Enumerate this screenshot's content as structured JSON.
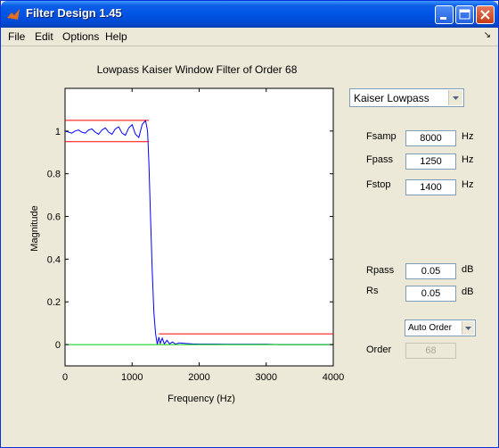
{
  "window": {
    "title": "Filter Design 1.45",
    "icon": "matlab-icon",
    "controls": [
      "minimize-icon",
      "maximize-icon",
      "close-icon"
    ]
  },
  "menu": [
    "File",
    "Edit",
    "Options",
    "Help"
  ],
  "plot": {
    "title": "Lowpass Kaiser Window Filter of Order 68",
    "xlabel": "Frequency (Hz)",
    "ylabel": "Magnitude"
  },
  "chart_data": {
    "type": "line",
    "title": "Lowpass Kaiser Window Filter of Order 68",
    "xlabel": "Frequency (Hz)",
    "ylabel": "Magnitude",
    "xlim": [
      0,
      4000
    ],
    "ylim": [
      -0.1,
      1.2
    ],
    "xticks": [
      "0",
      "1000",
      "2000",
      "3000",
      "4000"
    ],
    "yticks": [
      "0",
      "0.2",
      "0.4",
      "0.6",
      "0.8",
      "1"
    ],
    "grid": false,
    "series": [
      {
        "role": "magnitude response",
        "color": "#0000ff",
        "x": [
          0,
          50,
          100,
          150,
          200,
          250,
          300,
          350,
          400,
          450,
          500,
          550,
          600,
          650,
          700,
          750,
          800,
          850,
          900,
          950,
          1000,
          1050,
          1100,
          1150,
          1200,
          1230,
          1250,
          1275,
          1300,
          1325,
          1350,
          1375,
          1400,
          1420,
          1450,
          1480,
          1520,
          1560,
          1600,
          1650,
          1700,
          1800,
          1900,
          2000,
          2200,
          2400,
          2600,
          2800,
          3000,
          3200,
          3400,
          3600,
          3800,
          4000
        ],
        "y": [
          1.0,
          0.995,
          0.99,
          1.0,
          1.005,
          0.995,
          0.99,
          1.005,
          1.01,
          0.995,
          0.985,
          1.005,
          1.015,
          0.995,
          0.985,
          1.01,
          1.02,
          0.99,
          0.98,
          1.015,
          1.03,
          0.985,
          0.97,
          1.03,
          1.05,
          1.0,
          0.85,
          0.6,
          0.35,
          0.15,
          0.05,
          0.0,
          0.035,
          0.005,
          0.03,
          0.003,
          0.02,
          0.003,
          0.012,
          0.002,
          0.008,
          0.005,
          0.003,
          0.002,
          0.002,
          0.001,
          0.001,
          0.001,
          0.001,
          0.0,
          0.0,
          0.0,
          0.0,
          0.0
        ]
      },
      {
        "role": "passband upper limit",
        "color": "#ff0000",
        "x": [
          0,
          1250
        ],
        "y": [
          1.05,
          1.05
        ]
      },
      {
        "role": "passband lower limit",
        "color": "#ff0000",
        "x": [
          0,
          1250
        ],
        "y": [
          0.95,
          0.95
        ]
      },
      {
        "role": "stopband limit",
        "color": "#ff0000",
        "x": [
          1400,
          4000
        ],
        "y": [
          0.05,
          0.05
        ]
      },
      {
        "role": "zero line",
        "color": "#00cc00",
        "x": [
          0,
          4000
        ],
        "y": [
          0,
          0
        ]
      }
    ]
  },
  "controls": {
    "filter_type": "Kaiser Lowpass",
    "fsamp": {
      "label": "Fsamp",
      "value": "8000",
      "unit": "Hz"
    },
    "fpass": {
      "label": "Fpass",
      "value": "1250",
      "unit": "Hz"
    },
    "fstop": {
      "label": "Fstop",
      "value": "1400",
      "unit": "Hz"
    },
    "rpass": {
      "label": "Rpass",
      "value": "0.05",
      "unit": "dB"
    },
    "rs": {
      "label": "Rs",
      "value": "0.05",
      "unit": "dB"
    },
    "order_mode": "Auto Order",
    "order": {
      "label": "Order",
      "value": "68"
    }
  }
}
